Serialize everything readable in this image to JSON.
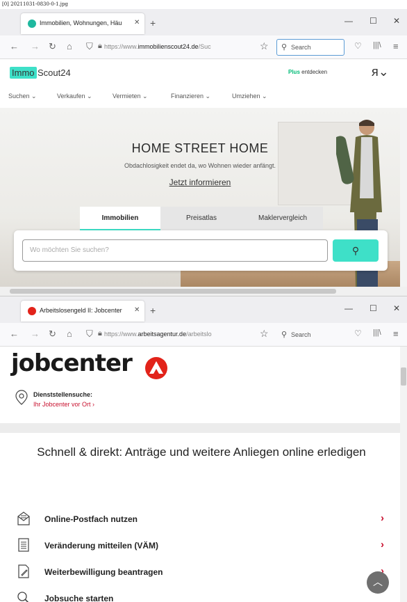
{
  "caption": "[0] 20211031-0830-0-1.jpg",
  "window1": {
    "tab_title": "Immobilien, Wohnungen, Häu",
    "url_prefix": "https://www.",
    "url_host": "immobilienscout24.de",
    "url_rest": "/Suc",
    "search_placeholder": "Search",
    "logo_immo": "Immo",
    "logo_scout": "Scout24",
    "plus_label": "Plus",
    "plus_sub": "entdecken",
    "menu": [
      "Suchen",
      "Verkaufen",
      "Vermieten",
      "Finanzieren",
      "Umziehen"
    ],
    "hero_title": "HOME STREET HOME",
    "hero_sub": "Obdachlosigkeit endet da, wo Wohnen wieder anfängt.",
    "hero_link": "Jetzt informieren",
    "tabs": [
      "Immobilien",
      "Preisatlas",
      "Maklervergleich"
    ],
    "search_input_placeholder": "Wo möchten Sie suchen?"
  },
  "window2": {
    "tab_title": "Arbeitslosengeld II: Jobcenter",
    "url_prefix": "https://www.",
    "url_host": "arbeitsagentur.de",
    "url_rest": "/arbeitslo",
    "search_placeholder": "Search",
    "logo": "jobcenter",
    "dienst_title": "Dienststellensuche:",
    "dienst_link": "Ihr Jobcenter vor Ort",
    "heading": "Schnell & direkt: Anträge und weitere Anliegen online erledigen",
    "rows": [
      "Online-Postfach nutzen",
      "Veränderung mitteilen (VÄM)",
      "Weiterbewilligung beantragen",
      "Jobsuche starten"
    ]
  },
  "colors": {
    "immo_accent": "#3ee0c8",
    "jobcenter_red": "#e2231a",
    "link_red": "#c8102e"
  }
}
